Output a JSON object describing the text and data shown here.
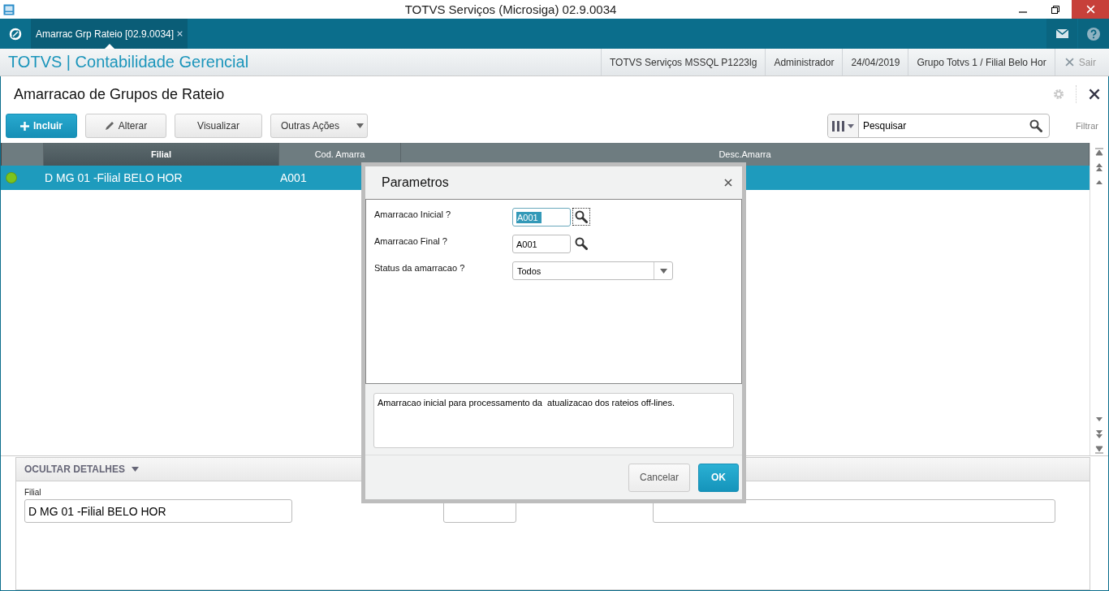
{
  "window": {
    "title": "TOTVS Serviços (Microsiga) 02.9.0034"
  },
  "tabs": [
    {
      "label": "Amarrac Grp Rateio [02.9.0034]",
      "selected": true
    }
  ],
  "header": {
    "module": "TOTVS | Contabilidade Gerencial",
    "info": [
      "TOTVS Serviços MSSQL P1223lg",
      "Administrador",
      "24/04/2019",
      "Grupo Totvs 1 / Filial Belo Hor"
    ],
    "exit": "Sair"
  },
  "page": {
    "title": "Amarracao de Grupos de Rateio"
  },
  "toolbar": {
    "buttons": [
      {
        "label": "Incluir",
        "kind": "primary"
      },
      {
        "label": "Alterar",
        "kind": "edit"
      },
      {
        "label": "Visualizar",
        "kind": "plain"
      },
      {
        "label": "Outras Ações",
        "kind": "menu"
      }
    ],
    "search": {
      "placeholder": "Pesquisar"
    },
    "filter": "Filtrar"
  },
  "grid": {
    "columns": [
      "Filial",
      "Cod. Amarra",
      "Desc.Amarra"
    ],
    "rows": [
      {
        "color": "#7cc41e",
        "selected": true,
        "cells": [
          "D MG 01 -Filial BELO HOR",
          "A001",
          ""
        ]
      }
    ]
  },
  "details": {
    "toggle": "OCULTAR DETALHES",
    "fields": [
      {
        "label": "Filial",
        "value": "D MG 01 -Filial BELO HOR"
      }
    ]
  },
  "dialog": {
    "title": "Parametros",
    "params": [
      {
        "label": "Amarracao Inicial ?",
        "value": "A001",
        "kind": "lookup",
        "focused": true
      },
      {
        "label": "Amarracao Final ?",
        "value": "A001",
        "kind": "lookup",
        "focused": false
      },
      {
        "label": "Status da amarracao ?",
        "value": "Todos",
        "kind": "select"
      }
    ],
    "help": "Amarracao inicial para processamento da  atualizacao dos rateios off-lines.",
    "buttons": [
      {
        "label": "Cancelar",
        "kind": "secondary"
      },
      {
        "label": "OK",
        "kind": "primary"
      }
    ]
  }
}
